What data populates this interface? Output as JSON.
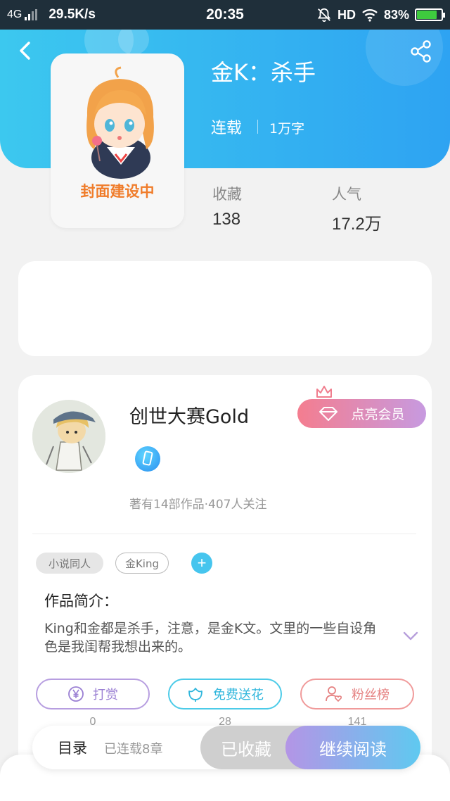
{
  "status_bar": {
    "network": "4G",
    "speed": "29.5K/s",
    "time": "20:35",
    "hd": "HD",
    "battery_percent": "83%",
    "battery_level": 0.83
  },
  "book": {
    "title": "金K：杀手",
    "status": "连载",
    "word_count": "1万字",
    "cover_caption": "封面建设中",
    "stats": [
      {
        "label": "收藏",
        "value": "138"
      },
      {
        "label": "人气",
        "value": "17.2万"
      }
    ]
  },
  "author": {
    "name": "创世大赛Gold",
    "vip_label": "点亮会员",
    "meta": "著有14部作品·407人关注"
  },
  "tags": [
    "小说同人",
    "金King"
  ],
  "add_tag_symbol": "+",
  "intro": {
    "title": "作品简介：",
    "text": "King和金都是杀手，注意，是金K文。文里的一些自设角色是我闺帮我想出来的。"
  },
  "actions": [
    {
      "label": "打赏",
      "count": "0",
      "icon": "yen-coin-icon"
    },
    {
      "label": "免费送花",
      "count": "28",
      "icon": "flower-icon"
    },
    {
      "label": "粉丝榜",
      "count": "141",
      "icon": "user-heart-icon"
    }
  ],
  "bottom_bar": {
    "toc_label": "目录",
    "toc_status": "已连载8章",
    "collected_label": "已收藏",
    "read_label": "继续阅读"
  },
  "colors": {
    "header_start": "#3cc8ef",
    "header_end": "#2ea3f2",
    "vip_start": "#f47d8f",
    "vip_end": "#c79ae0",
    "read_start": "#b495e6",
    "read_end": "#5fc9f0"
  }
}
